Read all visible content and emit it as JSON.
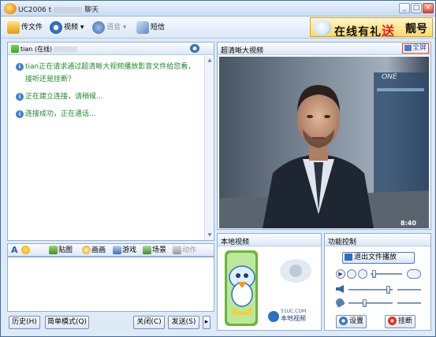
{
  "window": {
    "title_prefix": "UC2006 t",
    "title_suffix": "聊天",
    "minimize": "_",
    "maximize": "□",
    "close": "×"
  },
  "toolbar": {
    "file_label": "传文件",
    "video_label": "视频",
    "voice_label": "语音",
    "sms_label": "短信",
    "dropdown_arrow": "▾"
  },
  "banner": {
    "text_a": "在线有礼",
    "text_b": "送",
    "text_c": "靓号"
  },
  "chat": {
    "contact": "tian (在线)",
    "messages": [
      {
        "icon": "i",
        "text": "tian正在请求通过超清晰大视频播放影音文件给您看，接听还是挂断？"
      },
      {
        "icon": "i",
        "text": "正在建立连接，请稍候..."
      },
      {
        "icon": "i",
        "text": "连接成功，正在通话..."
      }
    ]
  },
  "input_toolbar": {
    "font_icon": "A",
    "sticker_label": "贴图",
    "draw_label": "画画",
    "game_label": "游戏",
    "scene_label": "场景",
    "action_label": "动作"
  },
  "bottom_buttons": {
    "history": "历史(H)",
    "simple_mode": "简单模式(Q)",
    "close": "关闭(C)",
    "send": "发送(S)",
    "arrow": "▸"
  },
  "video": {
    "header": "超清晰大视频",
    "fullscreen": "全屏",
    "bug_logo": "ONE",
    "clock": "8:40"
  },
  "local_video": {
    "header": "本地视频",
    "site": "51UC.COM",
    "brand": "本地视频"
  },
  "controls": {
    "header": "功能控制",
    "exit_playback": "退出文件播放",
    "settings": "设置",
    "hangup": "挂断"
  },
  "colors": {
    "accent": "#3a6ea5",
    "message_text": "#1f8a2a",
    "fullscreen_border": "#e23a2a"
  },
  "icons": [
    "app-logo-icon",
    "file-transfer-icon",
    "video-icon",
    "voice-icon",
    "sms-icon",
    "contact-status-icon",
    "camera-icon",
    "info-icon",
    "font-icon",
    "emoticon-icon",
    "sticker-icon",
    "draw-icon",
    "game-icon",
    "scene-icon",
    "action-icon",
    "fullscreen-icon",
    "exit-playback-icon",
    "play-icon",
    "stop-icon",
    "speaker-icon",
    "mic-icon",
    "settings-icon",
    "hangup-icon"
  ]
}
